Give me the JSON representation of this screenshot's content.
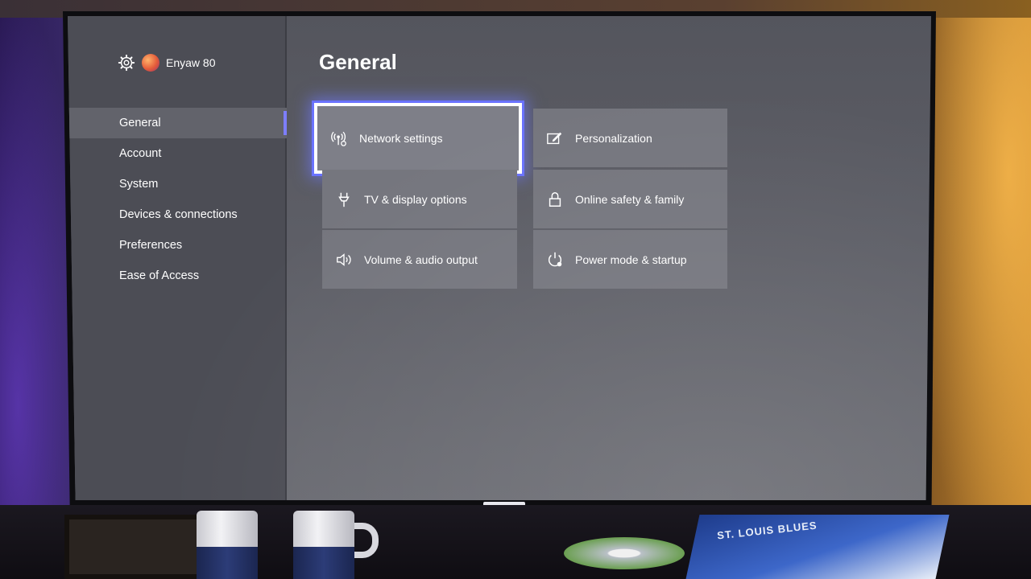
{
  "profile": {
    "gamertag": "Enyaw 80",
    "icon": "gear-icon"
  },
  "nav": {
    "items": [
      {
        "label": "General",
        "active": true
      },
      {
        "label": "Account",
        "active": false
      },
      {
        "label": "System",
        "active": false
      },
      {
        "label": "Devices & connections",
        "active": false
      },
      {
        "label": "Preferences",
        "active": false
      },
      {
        "label": "Ease of Access",
        "active": false
      }
    ]
  },
  "main": {
    "title": "General",
    "tiles": [
      {
        "label": "Network settings",
        "icon": "wireless-icon",
        "focused": true
      },
      {
        "label": "Personalization",
        "icon": "pencil-icon",
        "focused": false
      },
      {
        "label": "TV & display options",
        "icon": "antenna-icon",
        "focused": false
      },
      {
        "label": "Online safety & family",
        "icon": "lock-icon",
        "focused": false
      },
      {
        "label": "Volume & audio output",
        "icon": "speaker-icon",
        "focused": false
      },
      {
        "label": "Power mode & startup",
        "icon": "power-icon",
        "focused": false
      }
    ]
  },
  "scene": {
    "magazine_text": "ST. LOUIS BLUES"
  },
  "colors": {
    "focus_glow": "#6a72ff",
    "nav_indicator": "#7d7eff",
    "tile": "#75767e",
    "sidebar": "#4c4d55"
  }
}
